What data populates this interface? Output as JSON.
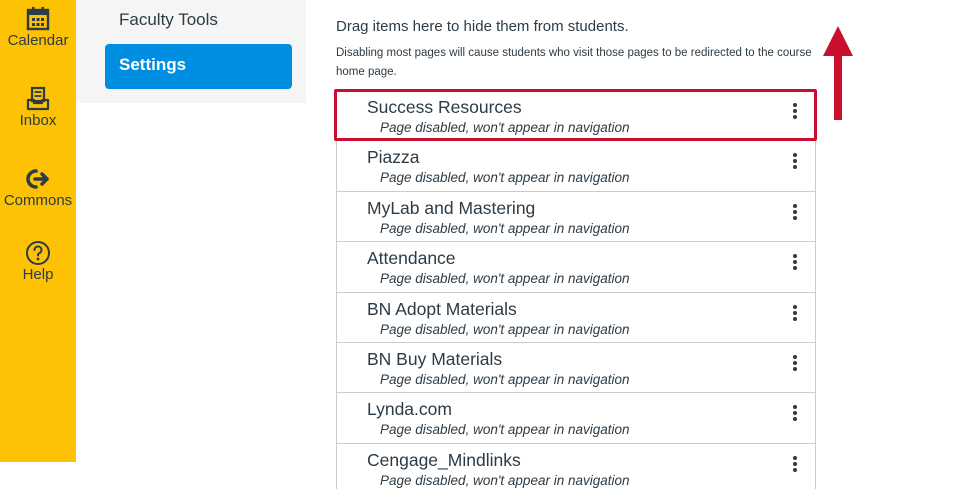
{
  "global_nav": {
    "items": [
      {
        "label": "Calendar",
        "icon": "calendar-icon"
      },
      {
        "label": "Inbox",
        "icon": "inbox-icon"
      },
      {
        "label": "Commons",
        "icon": "commons-icon"
      },
      {
        "label": "Help",
        "icon": "help-icon"
      }
    ],
    "bg_color": "#fcc203"
  },
  "course_nav": {
    "items": [
      {
        "label": "Faculty Tools",
        "active": false
      },
      {
        "label": "Settings",
        "active": true
      }
    ],
    "active_color": "#008ee2"
  },
  "main": {
    "drag_hint": "Drag items here to hide them from students.",
    "disable_note": "Disabling most pages will cause students who visit those pages to be redirected to the course home page.",
    "disabled_items": [
      {
        "title": "Success Resources",
        "subtitle": "Page disabled, won't appear in navigation",
        "highlighted": true
      },
      {
        "title": "Piazza",
        "subtitle": "Page disabled, won't appear in navigation"
      },
      {
        "title": "MyLab and Mastering",
        "subtitle": "Page disabled, won't appear in navigation"
      },
      {
        "title": "Attendance",
        "subtitle": "Page disabled, won't appear in navigation"
      },
      {
        "title": "BN Adopt Materials",
        "subtitle": "Page disabled, won't appear in navigation"
      },
      {
        "title": "BN Buy Materials",
        "subtitle": "Page disabled, won't appear in navigation"
      },
      {
        "title": "Lynda.com",
        "subtitle": "Page disabled, won't appear in navigation"
      },
      {
        "title": "Cengage_Mindlinks",
        "subtitle": "Page disabled, won't appear in navigation"
      }
    ]
  },
  "annotation": {
    "highlight_color": "#c8102e",
    "arrow_icon": "red-up-arrow"
  }
}
